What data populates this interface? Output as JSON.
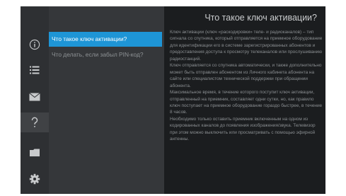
{
  "sidebar": {
    "icons": [
      {
        "name": "info-icon"
      },
      {
        "name": "list-icon"
      },
      {
        "name": "mail-icon"
      },
      {
        "name": "help-icon",
        "active": true
      },
      {
        "name": "folder-icon"
      },
      {
        "name": "settings-gear-icon"
      }
    ]
  },
  "menu": {
    "items": [
      {
        "label": "Что такое ключ активации?",
        "active": true
      },
      {
        "label": "Что делать, если забыл PIN-код?",
        "active": false
      }
    ]
  },
  "content": {
    "title": "Что такое ключ активации?",
    "paragraphs": [
      "Ключ активации (ключ «раскодировки» теле- и радиоканалов) – тип сигнала со спутника, который отправляется на приемное оборудование для идентификации его в системе зарегистрированных абонентов и предоставления доступа к просмотру телеканалов или прослушиванию радиостанций.",
      "Ключ отправляется со спутника автоматически, и также дополнительно может быть отправлен абонентом из Личного кабинета абонента на сайте или специалистом технической поддержки при обращении абонента.",
      "Максимальное время, в течение которого поступит ключ активации, отправленный на приемник, составляет одни сутки, но, как правило ключ поступает на приемное оборудование гораздо быстрее, в течение 8 часов.",
      "Необходимо только оставить приемник включенным на одном из кодированных каналов до появления изображения/звука. Телевизор при этом можно выключить или просматривать с помощью эфирной антенны."
    ]
  },
  "colors": {
    "accent": "#1e95d6",
    "icon": "#c8cacc",
    "title": "#c9cbcd",
    "body_text": "#8a8e91"
  }
}
